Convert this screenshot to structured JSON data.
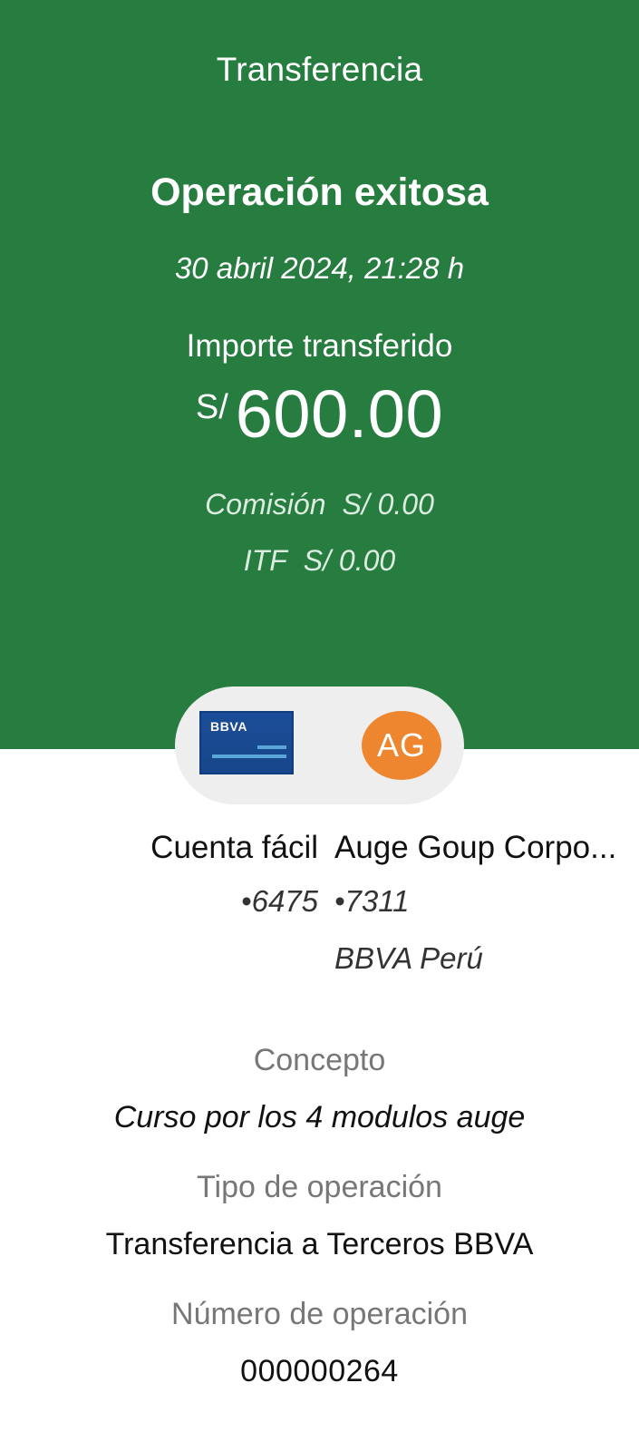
{
  "header": {
    "title": "Transferencia",
    "status": "Operación exitosa",
    "datetime": "30 abril 2024, 21:28 h",
    "amount_label": "Importe transferido",
    "currency": "S/",
    "amount": "600.00",
    "commission_label": "Comisión",
    "commission_value": "S/ 0.00",
    "itf_label": "ITF",
    "itf_value": "S/ 0.00",
    "background_color": "#277c40"
  },
  "accounts": {
    "origin": {
      "icon": "bbva-card-icon",
      "card_brand": "BBVA",
      "name": "Cuenta fácil",
      "number": "•6475"
    },
    "destination": {
      "initials": "AG",
      "avatar_color": "#ee8630",
      "name": "Auge Goup Corpo...",
      "number": "•7311",
      "bank": "BBVA Perú"
    }
  },
  "details": {
    "concept_label": "Concepto",
    "concept_value": "Curso por los 4 modulos auge",
    "type_label": "Tipo de operación",
    "type_value": "Transferencia a Terceros BBVA",
    "opnum_label": "Número de operación",
    "opnum_value": "000000264"
  }
}
